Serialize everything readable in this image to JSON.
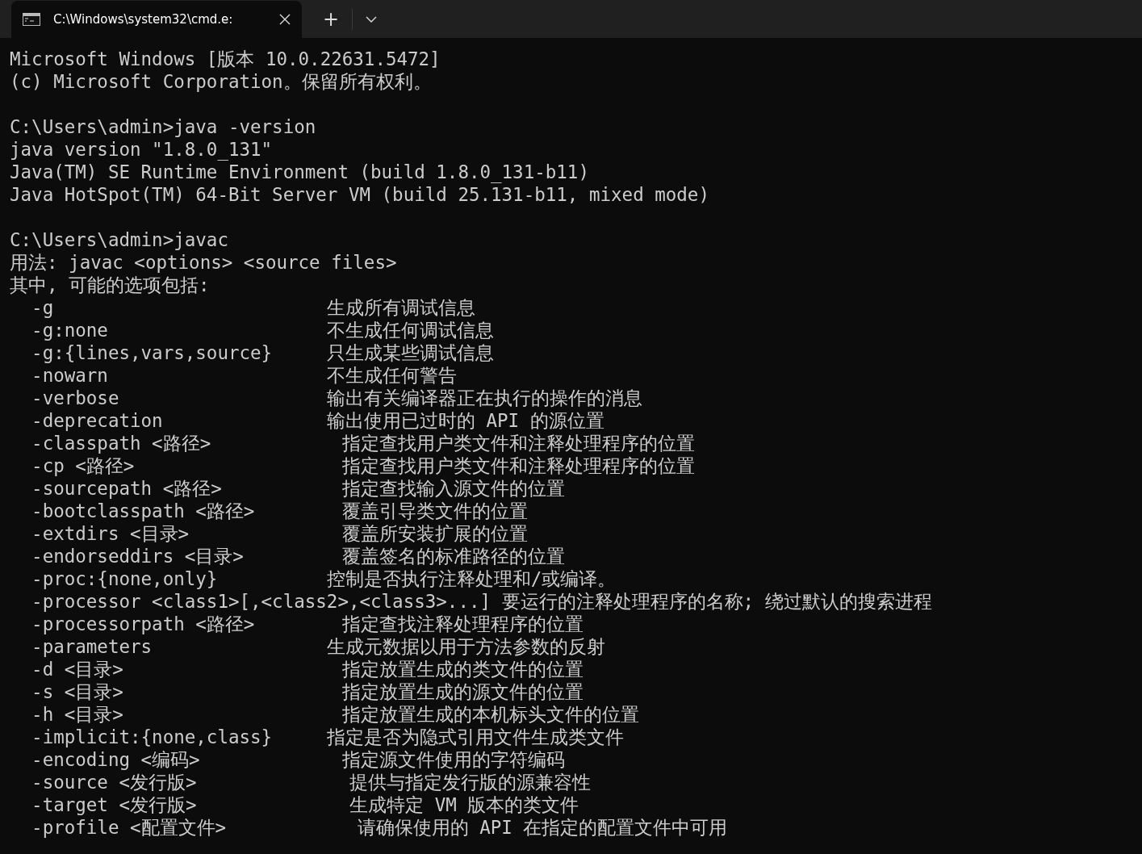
{
  "tabs": [
    {
      "title": "C:\\Windows\\system32\\cmd.e:",
      "selected": true
    }
  ],
  "new_tab_button": "+",
  "console_blocks": [
    [
      "Microsoft Windows [版本 10.0.22631.5472]",
      "(c) Microsoft Corporation。保留所有权利。"
    ],
    [
      "C:\\Users\\admin>java -version",
      "java version \"1.8.0_131\"",
      "Java(TM) SE Runtime Environment (build 1.8.0_131-b11)",
      "Java HotSpot(TM) 64-Bit Server VM (build 25.131-b11, mixed mode)"
    ],
    [
      "C:\\Users\\admin>javac",
      "用法: javac <options> <source files>",
      "其中, 可能的选项包括:",
      "  -g                         生成所有调试信息",
      "  -g:none                    不生成任何调试信息",
      "  -g:{lines,vars,source}     只生成某些调试信息",
      "  -nowarn                    不生成任何警告",
      "  -verbose                   输出有关编译器正在执行的操作的消息",
      "  -deprecation               输出使用已过时的 API 的源位置",
      "  -classpath <路径>            指定查找用户类文件和注释处理程序的位置",
      "  -cp <路径>                   指定查找用户类文件和注释处理程序的位置",
      "  -sourcepath <路径>           指定查找输入源文件的位置",
      "  -bootclasspath <路径>        覆盖引导类文件的位置",
      "  -extdirs <目录>              覆盖所安装扩展的位置",
      "  -endorseddirs <目录>         覆盖签名的标准路径的位置",
      "  -proc:{none,only}          控制是否执行注释处理和/或编译。",
      "  -processor <class1>[,<class2>,<class3>...] 要运行的注释处理程序的名称; 绕过默认的搜索进程",
      "  -processorpath <路径>        指定查找注释处理程序的位置",
      "  -parameters                生成元数据以用于方法参数的反射",
      "  -d <目录>                    指定放置生成的类文件的位置",
      "  -s <目录>                    指定放置生成的源文件的位置",
      "  -h <目录>                    指定放置生成的本机标头文件的位置",
      "  -implicit:{none,class}     指定是否为隐式引用文件生成类文件",
      "  -encoding <编码>             指定源文件使用的字符编码",
      "  -source <发行版>              提供与指定发行版的源兼容性",
      "  -target <发行版>              生成特定 VM 版本的类文件",
      "  -profile <配置文件>            请确保使用的 API 在指定的配置文件中可用"
    ]
  ]
}
